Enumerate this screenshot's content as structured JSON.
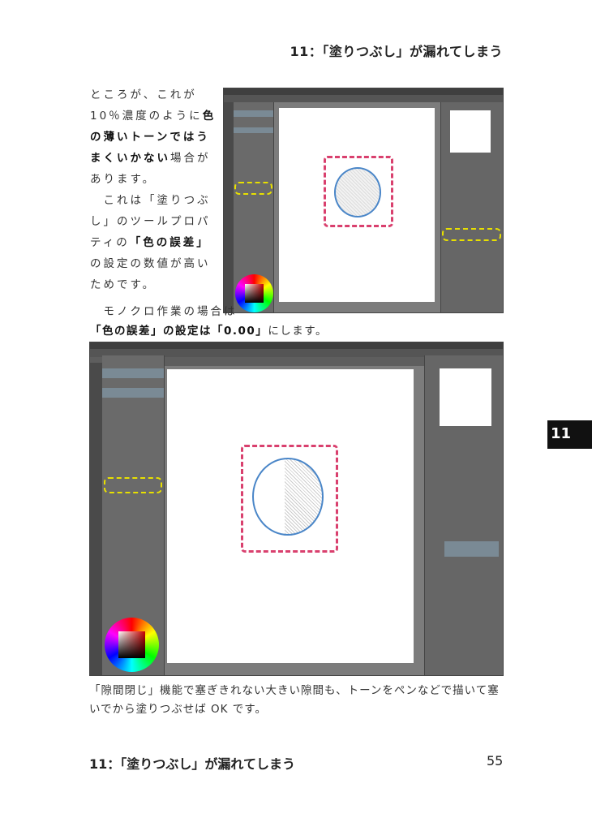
{
  "header": {
    "title": "11：「塗りつぶし」が漏れてしまう"
  },
  "body": {
    "p1_a": "ところが、これが10％濃度のように",
    "p1_bold": "色の薄いトーンではうまくいかない",
    "p1_b": "場合があります。",
    "p2_a": "これは「塗りつぶし」のツールプロパティの",
    "p2_bold": "「色の誤差」",
    "p2_b": "の設定の数値が高いためです。",
    "p3_a": "モノクロ作業の場合は",
    "p3_bold1": "「色の誤差」の設定は",
    "p3_bold2": "「0.00」",
    "p3_b": "にします。",
    "caption": "「隙間閉じ」機能で塞ぎきれない大きい隙間も、トーンをペンなどで描いて塞いでから塗りつぶせば OK です。"
  },
  "side_tab": {
    "label": "11"
  },
  "footer": {
    "title": "11：「塗りつぶし」が漏れてしまう",
    "page_number": "55"
  },
  "colors": {
    "highlight_pink": "#d9406e",
    "highlight_yellow": "#e8e000",
    "stroke_blue": "#4a86c8"
  }
}
